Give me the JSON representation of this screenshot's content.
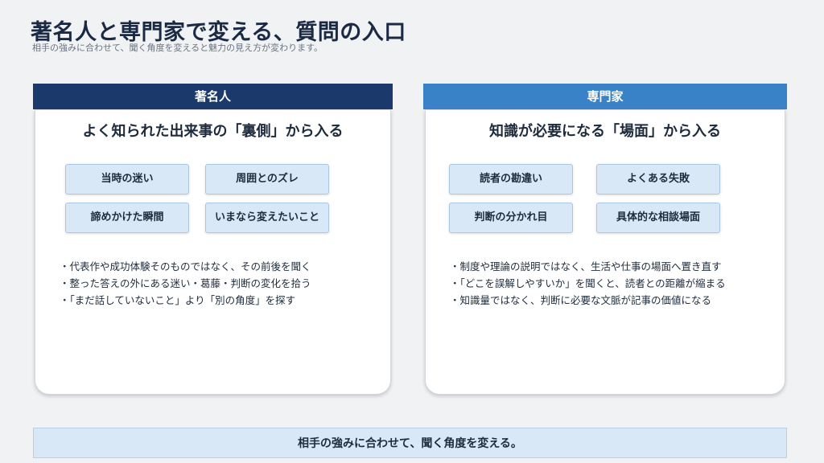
{
  "title": "著名人と専門家で変える、質問の入口",
  "subtitle": "相手の強みに合わせて、聞く角度を変えると魅力の見え方が変わります。",
  "left": {
    "header": "著名人",
    "card_title": "よく知られた出来事の「裏側」から入る",
    "tags": [
      "当時の迷い",
      "周囲とのズレ",
      "諦めかけた瞬間",
      "いまなら変えたいこと"
    ],
    "bullets": [
      "・代表作や成功体験そのものではなく、その前後を聞く",
      "・整った答えの外にある迷い・葛藤・判断の変化を拾う",
      "・「まだ話していないこと」より「別の角度」を探す"
    ]
  },
  "right": {
    "header": "専門家",
    "card_title": "知識が必要になる「場面」から入る",
    "tags": [
      "読者の勘違い",
      "よくある失敗",
      "判断の分かれ目",
      "具体的な相談場面"
    ],
    "bullets": [
      "・制度や理論の説明ではなく、生活や仕事の場面へ置き直す",
      "・「どこを誤解しやすいか」を聞くと、読者との距離が縮まる",
      "・知識量ではなく、判断に必要な文脈が記事の価値になる"
    ]
  },
  "banner": "相手の強みに合わせて、聞く角度を変える。",
  "colors": {
    "left_header": "#1b3a6b",
    "right_header": "#3a82c7",
    "tag_fill": "#d9e8f6",
    "background": "#f1f2f4"
  }
}
